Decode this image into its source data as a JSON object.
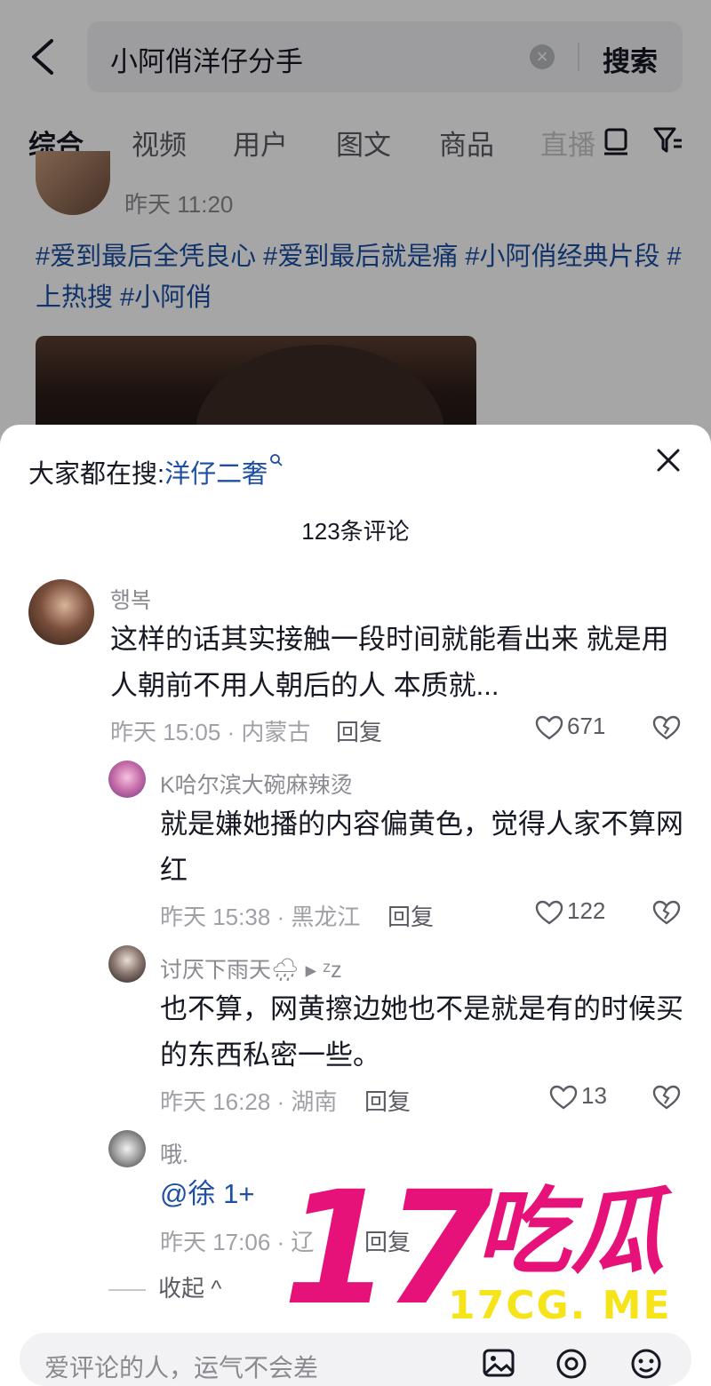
{
  "search": {
    "query": "小阿俏洋仔分手",
    "submit_label": "搜索"
  },
  "tabs": [
    "综合",
    "视频",
    "用户",
    "图文",
    "商品",
    "直播"
  ],
  "post": {
    "time": "昨天 11:20",
    "hashtags": "#爱到最后全凭良心 #爱到最后就是痛 #小阿俏经典片段 #上热搜 #小阿俏"
  },
  "sheet": {
    "trending_prefix": "大家都在搜:",
    "trending_keyword": "洋仔二奢",
    "comment_count": "123条评论"
  },
  "comments": [
    {
      "user": "행복",
      "text": "这样的话其实接触一段时间就能看出来 就是用人朝前不用人朝后的人 本质就...",
      "meta": "昨天 15:05 · 内蒙古",
      "reply": "回复",
      "likes": "671"
    },
    {
      "user": "K哈尔滨大碗麻辣烫",
      "text": "就是嫌她播的内容偏黄色，觉得人家不算网红",
      "meta": "昨天 15:38 · 黑龙江",
      "reply": "回复",
      "likes": "122"
    },
    {
      "user": "讨厌下雨天🌧 ▸ ᶻz",
      "text": "也不算，网黄擦边她也不是就是有的时候买的东西私密一些。",
      "meta": "昨天 16:28 · 湖南",
      "reply": "回复",
      "likes": "13"
    },
    {
      "user": "哦.",
      "text": "@徐 1+",
      "meta": "昨天 17:06 · 辽",
      "reply": "回复",
      "likes": ""
    }
  ],
  "collapse_label": "收起 ^",
  "input": {
    "placeholder": "爱评论的人，运气不会差"
  },
  "watermark": {
    "big": "17",
    "cn": "吃瓜",
    "url": "17CG. ME"
  },
  "colors": {
    "link": "#1d4fa3",
    "watermark_pink": "#e6127a",
    "watermark_yellow": "#f6e41a"
  }
}
